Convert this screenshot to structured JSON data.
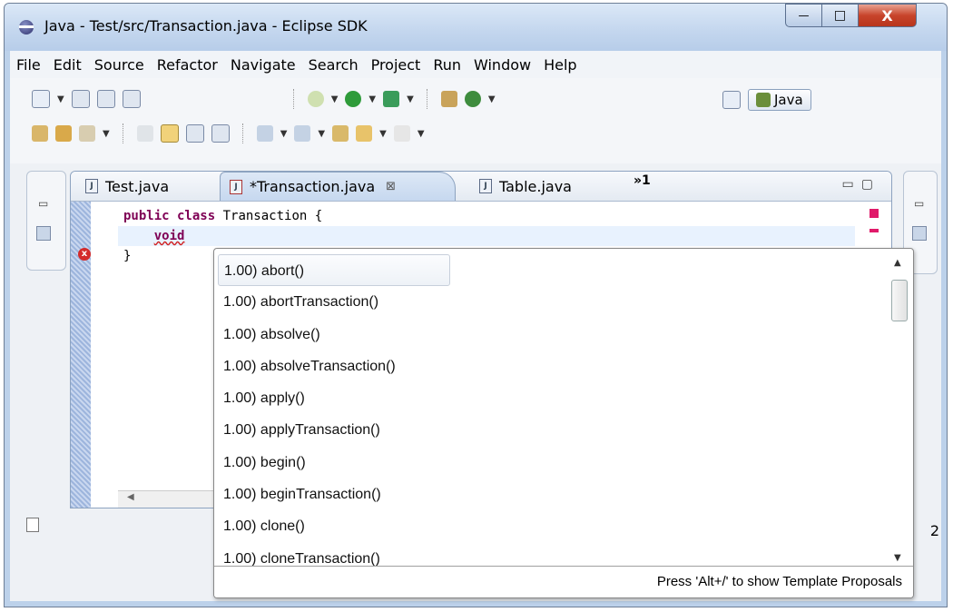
{
  "window": {
    "title": "Java - Test/src/Transaction.java - Eclipse SDK",
    "controls": {
      "minimize": "—",
      "maximize": "□",
      "close": "X"
    }
  },
  "menubar": [
    "File",
    "Edit",
    "Source",
    "Refactor",
    "Navigate",
    "Search",
    "Project",
    "Run",
    "Window",
    "Help"
  ],
  "perspective": {
    "label": "Java"
  },
  "editor": {
    "tabs": [
      {
        "label": "Test.java"
      },
      {
        "label": "*Transaction.java"
      },
      {
        "label": "Table.java"
      }
    ],
    "tab_overflow": "»1",
    "code": {
      "line1_kw": "public class",
      "line1_rest": " Transaction {",
      "line2_kw": "void",
      "line3": "}"
    }
  },
  "content_assist": {
    "proposals": [
      "1.00) abort()",
      "1.00) abortTransaction()",
      "1.00) absolve()",
      "1.00) absolveTransaction()",
      "1.00) apply()",
      "1.00) applyTransaction()",
      "1.00) begin()",
      "1.00) beginTransaction()",
      "1.00) clone()",
      "1.00) cloneTransaction()"
    ],
    "selected_index": 0,
    "status": "Press 'Alt+/' to show Template Proposals"
  },
  "right_edge_text": "2"
}
